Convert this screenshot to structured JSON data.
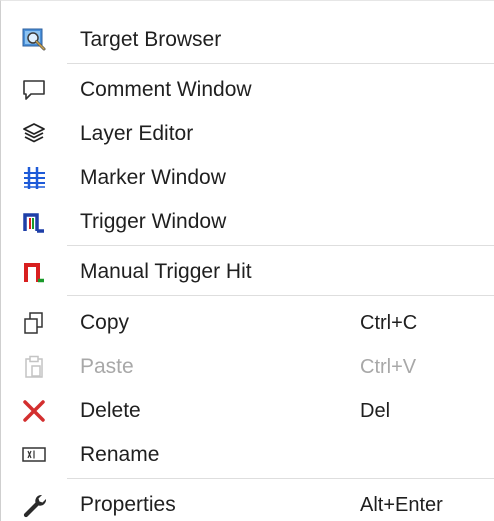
{
  "menu": {
    "items": [
      {
        "label": "Target Browser",
        "shortcut": "",
        "icon": "target-browser-icon",
        "enabled": true
      },
      {
        "label": "Comment Window",
        "shortcut": "",
        "icon": "comment-icon",
        "enabled": true
      },
      {
        "label": "Layer Editor",
        "shortcut": "",
        "icon": "layers-icon",
        "enabled": true
      },
      {
        "label": "Marker Window",
        "shortcut": "",
        "icon": "marker-icon",
        "enabled": true
      },
      {
        "label": "Trigger Window",
        "shortcut": "",
        "icon": "trigger-icon",
        "enabled": true
      },
      {
        "label": "Manual Trigger Hit",
        "shortcut": "",
        "icon": "manual-trigger-icon",
        "enabled": true
      },
      {
        "label": "Copy",
        "shortcut": "Ctrl+C",
        "icon": "copy-icon",
        "enabled": true
      },
      {
        "label": "Paste",
        "shortcut": "Ctrl+V",
        "icon": "paste-icon",
        "enabled": false
      },
      {
        "label": "Delete",
        "shortcut": "Del",
        "icon": "delete-icon",
        "enabled": true
      },
      {
        "label": "Rename",
        "shortcut": "",
        "icon": "rename-icon",
        "enabled": true
      },
      {
        "label": "Properties",
        "shortcut": "Alt+Enter",
        "icon": "wrench-icon",
        "enabled": true
      }
    ]
  },
  "colors": {
    "text": "#1f1f1f",
    "disabled_text": "#a8a8a8",
    "separator": "#dedede",
    "delete_red": "#d32f2f",
    "trigger_red": "#d81f1f",
    "trigger_green": "#1a9a2a",
    "marker_blue": "#1e5bd8"
  }
}
